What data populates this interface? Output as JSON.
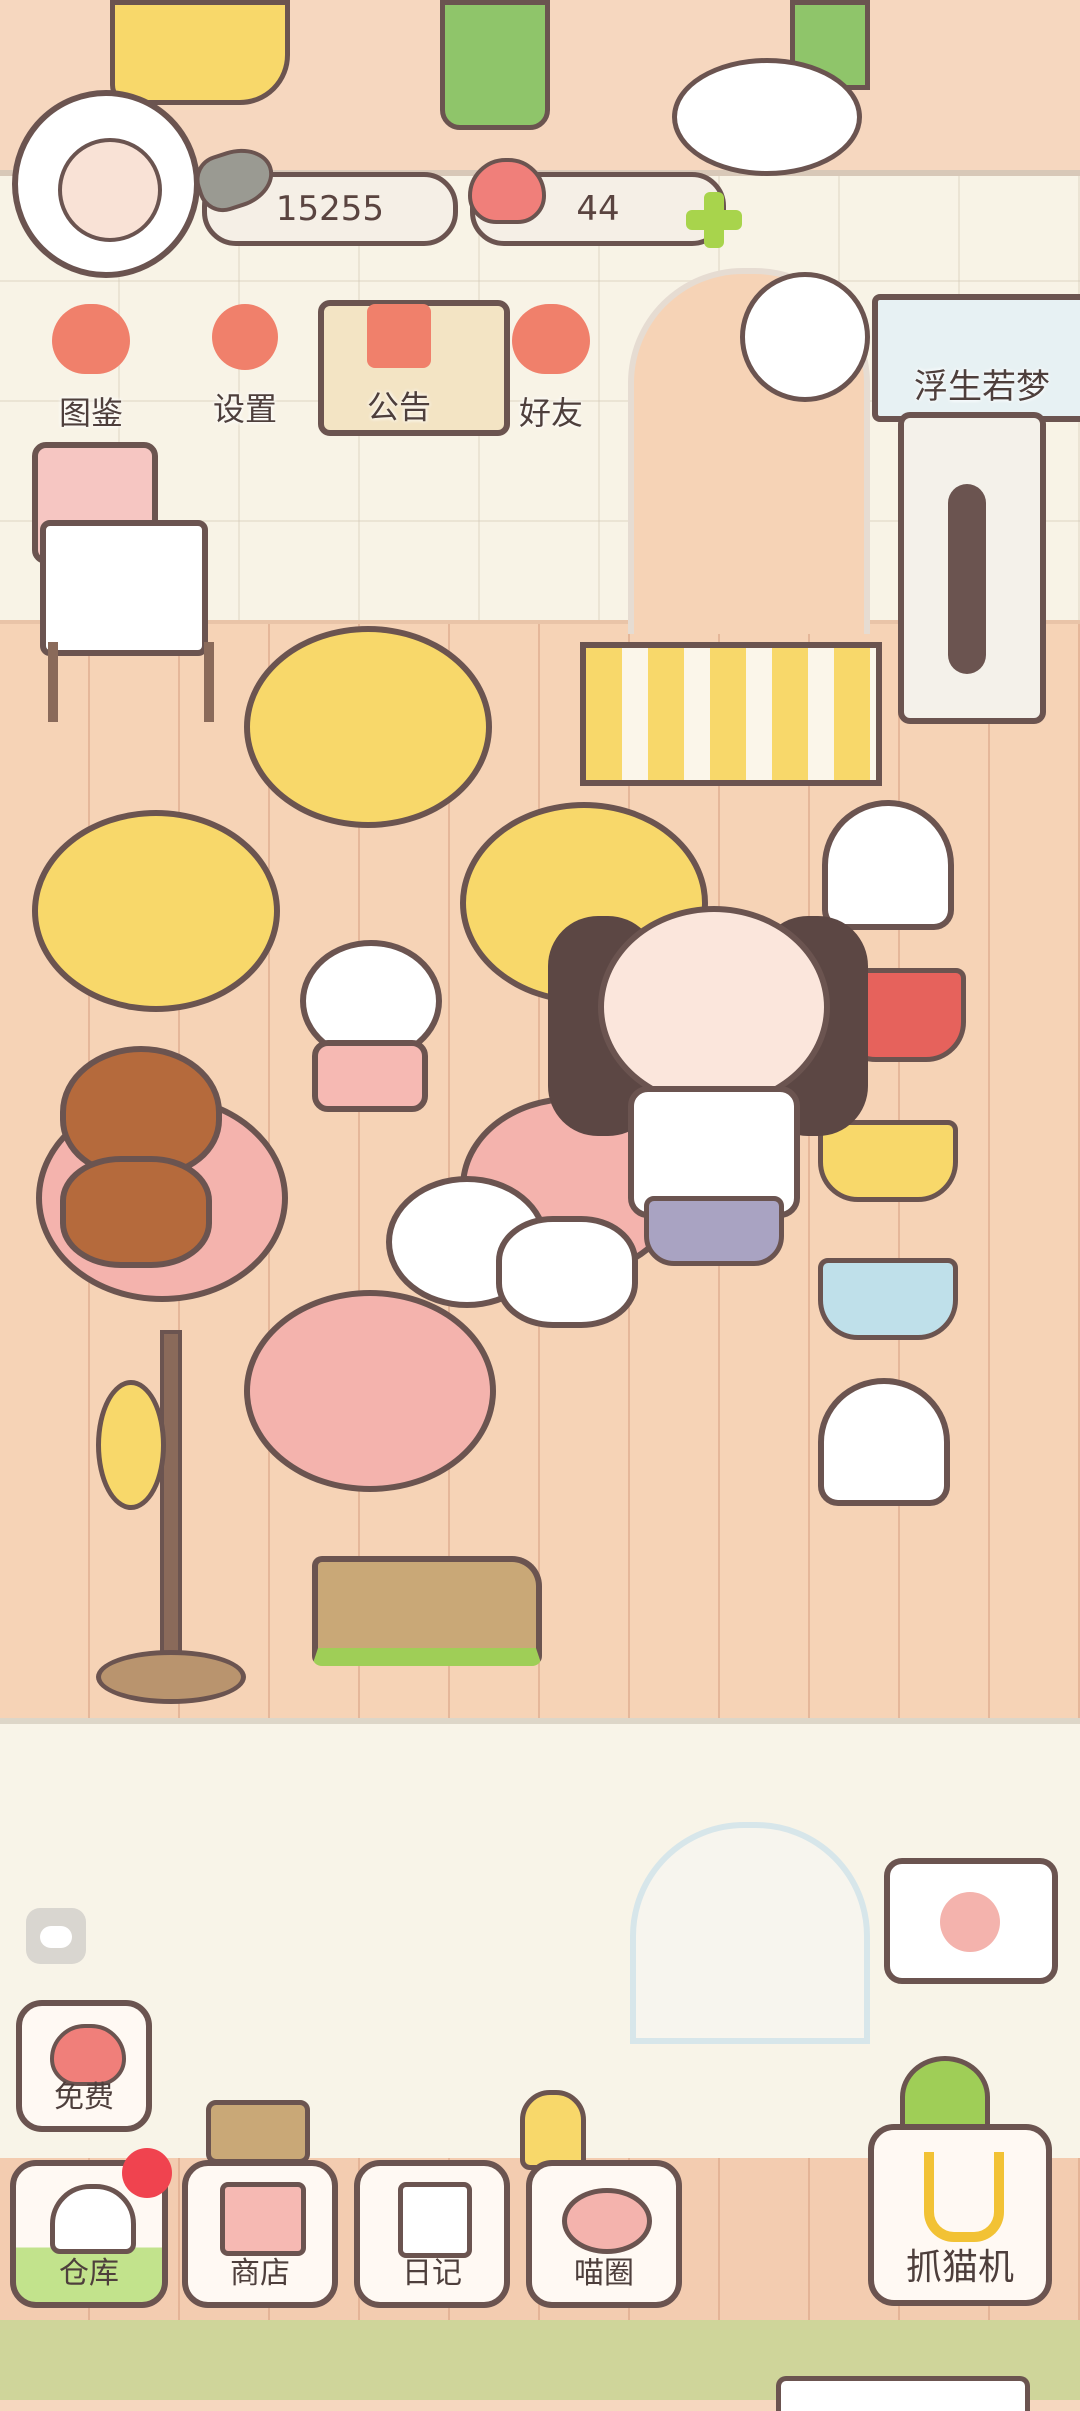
{
  "currency": {
    "fish_amount": "15255",
    "heart_amount": "44"
  },
  "top_menu": {
    "illustrated": "图鉴",
    "settings": "设置",
    "announcement": "公告",
    "friends": "好友"
  },
  "wall_sign": "浮生若梦",
  "bottom_nav": {
    "free": "免费",
    "warehouse": "仓库",
    "shop": "商店",
    "diary": "日记",
    "meow_circle": "喵圈",
    "claw_machine": "抓猫机"
  },
  "colors": {
    "outline": "#6b5450",
    "accent": "#f0806b",
    "notify": "#f0434f",
    "wall": "#f8f3e6",
    "floor": "#f6d3b6"
  },
  "icons": {
    "avatar": "avatar-icon",
    "fish": "fish-icon",
    "heart": "heart-icon",
    "add": "plus-icon",
    "cloud": "cloud-icon"
  }
}
